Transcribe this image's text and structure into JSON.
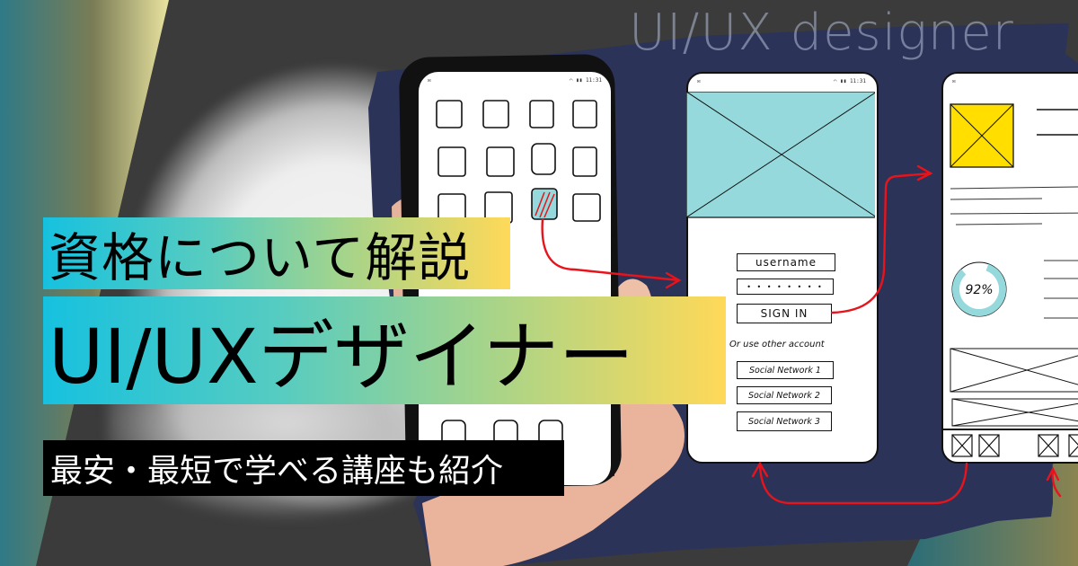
{
  "headline": {
    "line1": "資格について解説",
    "line2": "UI/UXデザイナー",
    "subtitle": "最安・最短で学べる講座も紹介"
  },
  "watermark": "UI/UX designer",
  "colors": {
    "band_gradient": [
      "#16c1df",
      "#57ccc0",
      "#a6d48a",
      "#ffd958"
    ],
    "navy": "#2c3358",
    "wireframe_cyan": "#95d9dc",
    "wireframe_yellow": "#ffde00",
    "arrow_red": "#e8131b",
    "subtitle_bg": "#000000"
  },
  "wireframes": {
    "status_time": "11:31",
    "login_screen": {
      "username_label": "username",
      "password_mask": "• • • • • • • •",
      "signin_label": "SIGN IN",
      "alt_label": "Or use other account",
      "social_buttons": [
        "Social Network 1",
        "Social Network 2",
        "Social Network 3"
      ]
    },
    "dashboard_screen": {
      "progress_label": "92%",
      "progress_value": 0.92
    }
  },
  "icons": [
    "mail-icon",
    "wifi-icon",
    "signal-icon",
    "battery-icon"
  ]
}
